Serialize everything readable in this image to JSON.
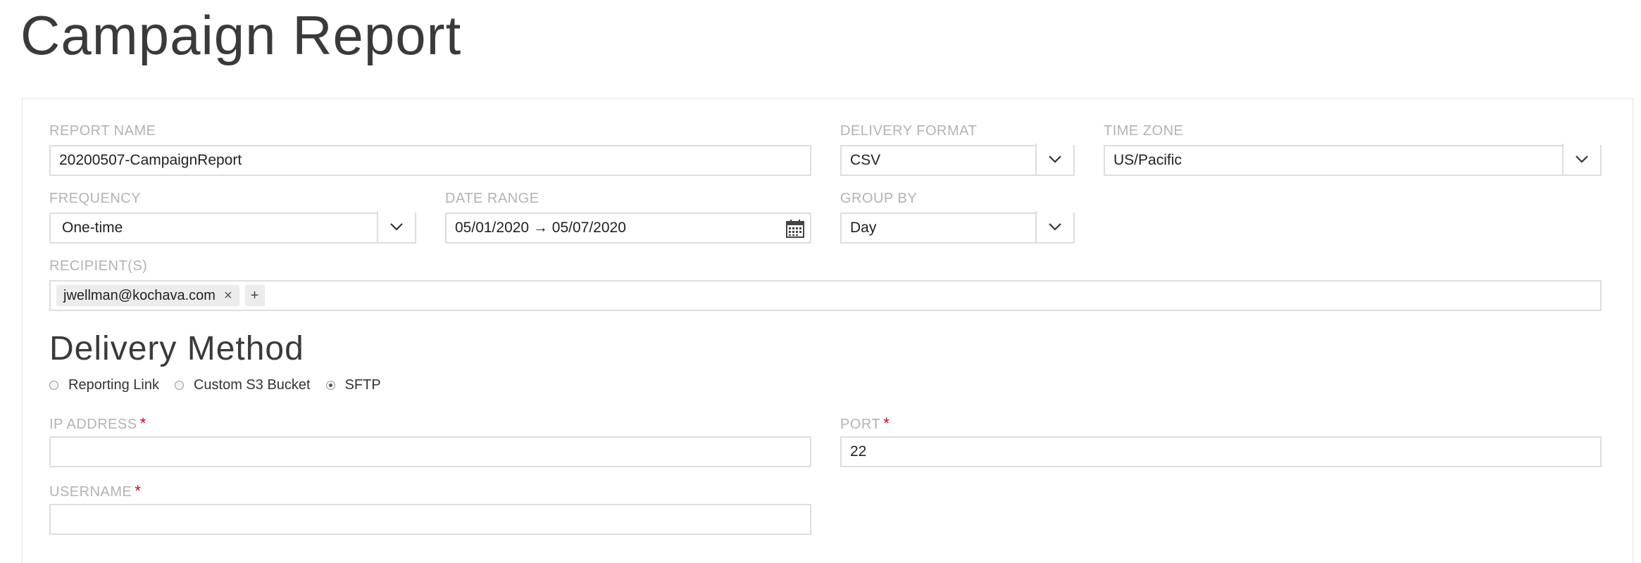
{
  "page": {
    "title": "Campaign Report"
  },
  "form": {
    "report_name": {
      "label": "REPORT NAME",
      "value": "20200507-CampaignReport"
    },
    "delivery_format": {
      "label": "DELIVERY FORMAT",
      "value": "CSV"
    },
    "time_zone": {
      "label": "TIME ZONE",
      "value": "US/Pacific"
    },
    "frequency": {
      "label": "FREQUENCY",
      "value": "One-time"
    },
    "date_range": {
      "label": "DATE RANGE",
      "value": "05/01/2020 → 05/07/2020"
    },
    "group_by": {
      "label": "GROUP BY",
      "value": "Day"
    },
    "recipients": {
      "label": "RECIPIENT(S)",
      "items": [
        "jwellman@kochava.com"
      ],
      "remove_glyph": "×",
      "add_glyph": "+"
    }
  },
  "delivery": {
    "title": "Delivery Method",
    "options": [
      "Reporting Link",
      "Custom S3 Bucket",
      "SFTP"
    ],
    "selected": "SFTP",
    "ip_address": {
      "label": "IP ADDRESS",
      "value": "",
      "required_mark": "*"
    },
    "port": {
      "label": "PORT",
      "value": "22",
      "required_mark": "*"
    },
    "username": {
      "label": "USERNAME",
      "value": "",
      "required_mark": "*"
    }
  },
  "icons": {
    "dropdown": "chevron-down-icon",
    "calendar": "calendar-icon",
    "required_color": "#d0021b"
  }
}
